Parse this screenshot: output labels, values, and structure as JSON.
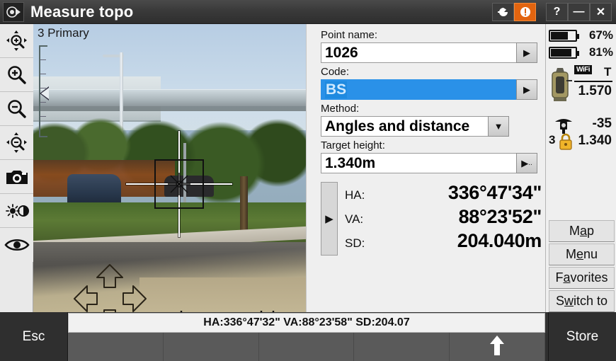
{
  "titlebar": {
    "app_icon": "survey-instrument-icon",
    "title": "Measure topo",
    "buttons": [
      {
        "name": "connect-icon",
        "glyph": "➔",
        "alert": false
      },
      {
        "name": "warning-icon",
        "glyph": "!",
        "alert": true
      },
      {
        "name": "help-button",
        "glyph": "?",
        "alert": false
      },
      {
        "name": "minimize-button",
        "glyph": "—",
        "alert": false
      },
      {
        "name": "close-button",
        "glyph": "✕",
        "alert": false
      }
    ]
  },
  "left_toolbar": {
    "items": [
      {
        "name": "zoom-to-fit-icon",
        "label": "Zoom to fit"
      },
      {
        "name": "zoom-in-icon",
        "label": "Zoom in"
      },
      {
        "name": "zoom-out-icon",
        "label": "Zoom out"
      },
      {
        "name": "pan-zoom-out-icon",
        "label": "Pan zoom out"
      },
      {
        "name": "camera-icon",
        "label": "Snapshot"
      },
      {
        "name": "brightness-contrast-icon",
        "label": "Brightness / contrast"
      },
      {
        "name": "visibility-icon",
        "label": "Show / hide overlay"
      }
    ]
  },
  "video": {
    "overlay_label": "3 Primary",
    "bottom_icons": [
      {
        "name": "target-low-icon"
      },
      {
        "name": "target-level-icon"
      },
      {
        "name": "target-high-icon"
      }
    ],
    "window_icon": "cascade-windows-icon",
    "navpad": "pan-navigation-pad",
    "crosshair": "aiming-crosshair"
  },
  "form": {
    "point_name": {
      "label": "Point name:",
      "value": "1026",
      "button": "▶"
    },
    "code": {
      "label": "Code:",
      "value": "BS",
      "selected": true,
      "button": "▶"
    },
    "method": {
      "label": "Method:",
      "value": "Angles and distance",
      "button": "▼"
    },
    "target_height": {
      "label": "Target height:",
      "value": "1.340m",
      "button": "▶"
    },
    "readings": {
      "expander": "▶",
      "rows": [
        {
          "key": "HA:",
          "value": "336°47'34\""
        },
        {
          "key": "VA:",
          "value": "88°23'52\""
        },
        {
          "key": "SD:",
          "value": "204.040m"
        }
      ]
    }
  },
  "status_panel": {
    "batteries": [
      {
        "name": "battery-1",
        "percent": "67%",
        "level": 67
      },
      {
        "name": "battery-2",
        "percent": "81%",
        "level": 81
      }
    ],
    "instrument": {
      "icon": "total-station-icon",
      "wifi_label": "WiFi",
      "target_letter": "T",
      "height": "1.570"
    },
    "target": {
      "icon": "prism-target-icon",
      "count": "3",
      "lock_icon": "lock-icon",
      "signal": "-35",
      "height": "1.340"
    },
    "softkeys": [
      {
        "name": "map-button",
        "pre": "M",
        "accel": "a",
        "post": "p"
      },
      {
        "name": "menu-button",
        "pre": "M",
        "accel": "e",
        "post": "nu"
      },
      {
        "name": "favorites-button",
        "pre": "F",
        "accel": "a",
        "post": "vorites"
      },
      {
        "name": "switch-to-button",
        "pre": "S",
        "accel": "w",
        "post": "itch to"
      }
    ]
  },
  "statusbar": {
    "text": "HA:336°47'32\"  VA:88°23'58\"  SD:204.07"
  },
  "bottom": {
    "esc_label": "Esc",
    "store_label": "Store",
    "soft_slots": [
      "",
      "",
      "",
      "",
      "arrow-up-icon"
    ],
    "arrow_icon": "arrow-up-icon"
  },
  "colors": {
    "titlebar": "#3a3a3a",
    "alert": "#e2640f",
    "selection": "#2a91e8",
    "panel": "#efefef",
    "dark_key": "#2f2f2f"
  }
}
